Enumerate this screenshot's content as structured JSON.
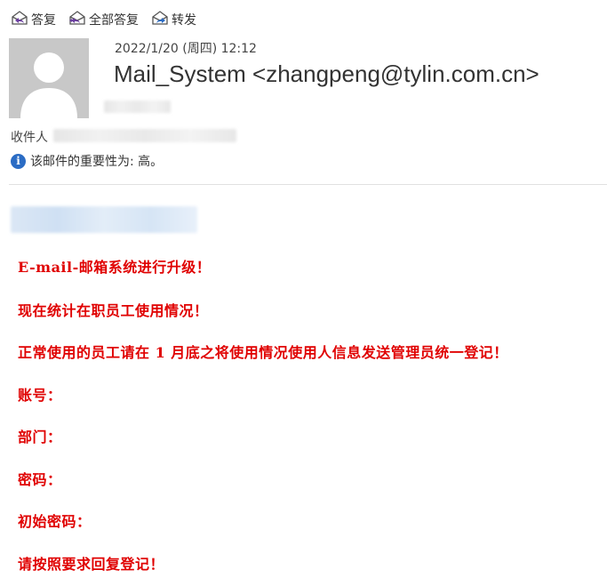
{
  "toolbar": {
    "reply": {
      "label": "答复",
      "icon": "reply-icon"
    },
    "reply_all": {
      "label": "全部答复",
      "icon": "reply-all-icon"
    },
    "forward": {
      "label": "转发",
      "icon": "forward-icon"
    }
  },
  "header": {
    "date": "2022/1/20 (周四) 12:12",
    "sender": "Mail_System <zhangpeng@tylin.com.cn>",
    "recipients_label": "收件人",
    "importance": "该邮件的重要性为: 高。"
  },
  "body": {
    "lines": [
      "E-mail-邮箱系统进行升级！",
      "现在统计在职员工使用情况！",
      "正常使用的员工请在 1 月底之将使用情况使用人信息发送管理员统一登记！",
      "账号：",
      "部门：",
      "密码：",
      "初始密码：",
      "请按照要求回复登记！"
    ]
  },
  "colors": {
    "body_text": "#e00000",
    "info_icon": "#2b6cc4",
    "avatar_bg": "#c8c8c8"
  }
}
